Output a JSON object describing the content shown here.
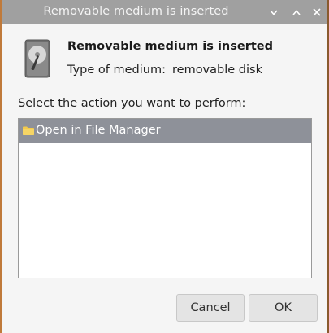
{
  "window": {
    "title": "Removable medium is inserted",
    "controls": {
      "minimize_icon": "chevron-down-icon",
      "maximize_icon": "chevron-up-icon",
      "close_icon": "close-icon"
    }
  },
  "dialog": {
    "icon": "hard-disk-icon",
    "heading": "Removable medium is inserted",
    "medium_label": "Type of medium:",
    "medium_value": "removable disk",
    "prompt": "Select the action you want to perform:",
    "actions": [
      {
        "label": "Open in File Manager",
        "icon": "folder-icon",
        "selected": true
      }
    ],
    "buttons": {
      "cancel": "Cancel",
      "ok": "OK"
    }
  },
  "colors": {
    "titlebar": "#a0a0a0",
    "selection": "#8e9199",
    "folder": "#f2c94c",
    "window_bg": "#f5f5f5"
  }
}
